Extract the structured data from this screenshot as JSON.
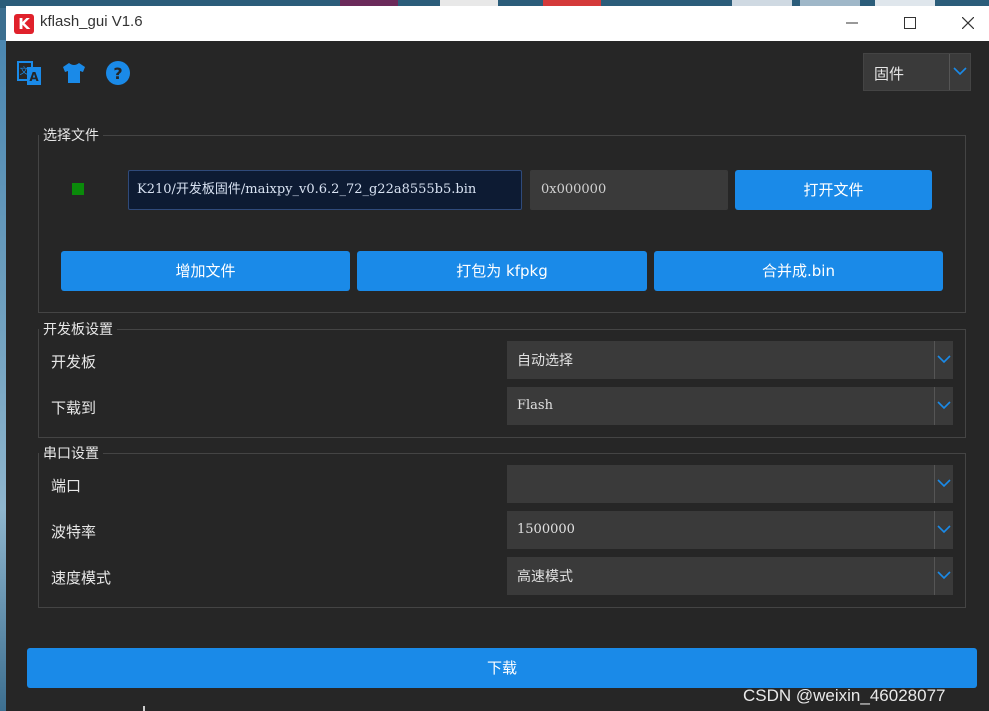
{
  "window": {
    "title": "kflash_gui V1.6",
    "logo_letter": "K"
  },
  "toolbar": {
    "icons": [
      "translate-icon",
      "theme-shirt-icon",
      "help-icon"
    ],
    "mode_select": {
      "value": "固件"
    }
  },
  "file_group": {
    "title": "选择文件",
    "file_path": "K210/开发板固件/maixpy_v0.6.2_72_g22a8555b5.bin",
    "address": "0x000000",
    "open_button": "打开文件",
    "add_file_button": "增加文件",
    "pack_button": "打包为 kfpkg",
    "merge_button": "合并成.bin",
    "status_color": "#0a8a0a"
  },
  "board_group": {
    "title": "开发板设置",
    "board_label": "开发板",
    "board_value": "自动选择",
    "download_to_label": "下载到",
    "download_to_value": "Flash"
  },
  "serial_group": {
    "title": "串口设置",
    "port_label": "端口",
    "port_value": "",
    "baud_label": "波特率",
    "baud_value": "1500000",
    "speed_label": "速度模式",
    "speed_value": "高速模式"
  },
  "download_button": "下载",
  "watermark": "CSDN @weixin_46028077",
  "colors": {
    "accent": "#1a8ae8",
    "background": "#262626",
    "input_bg": "#3a3a3a"
  }
}
